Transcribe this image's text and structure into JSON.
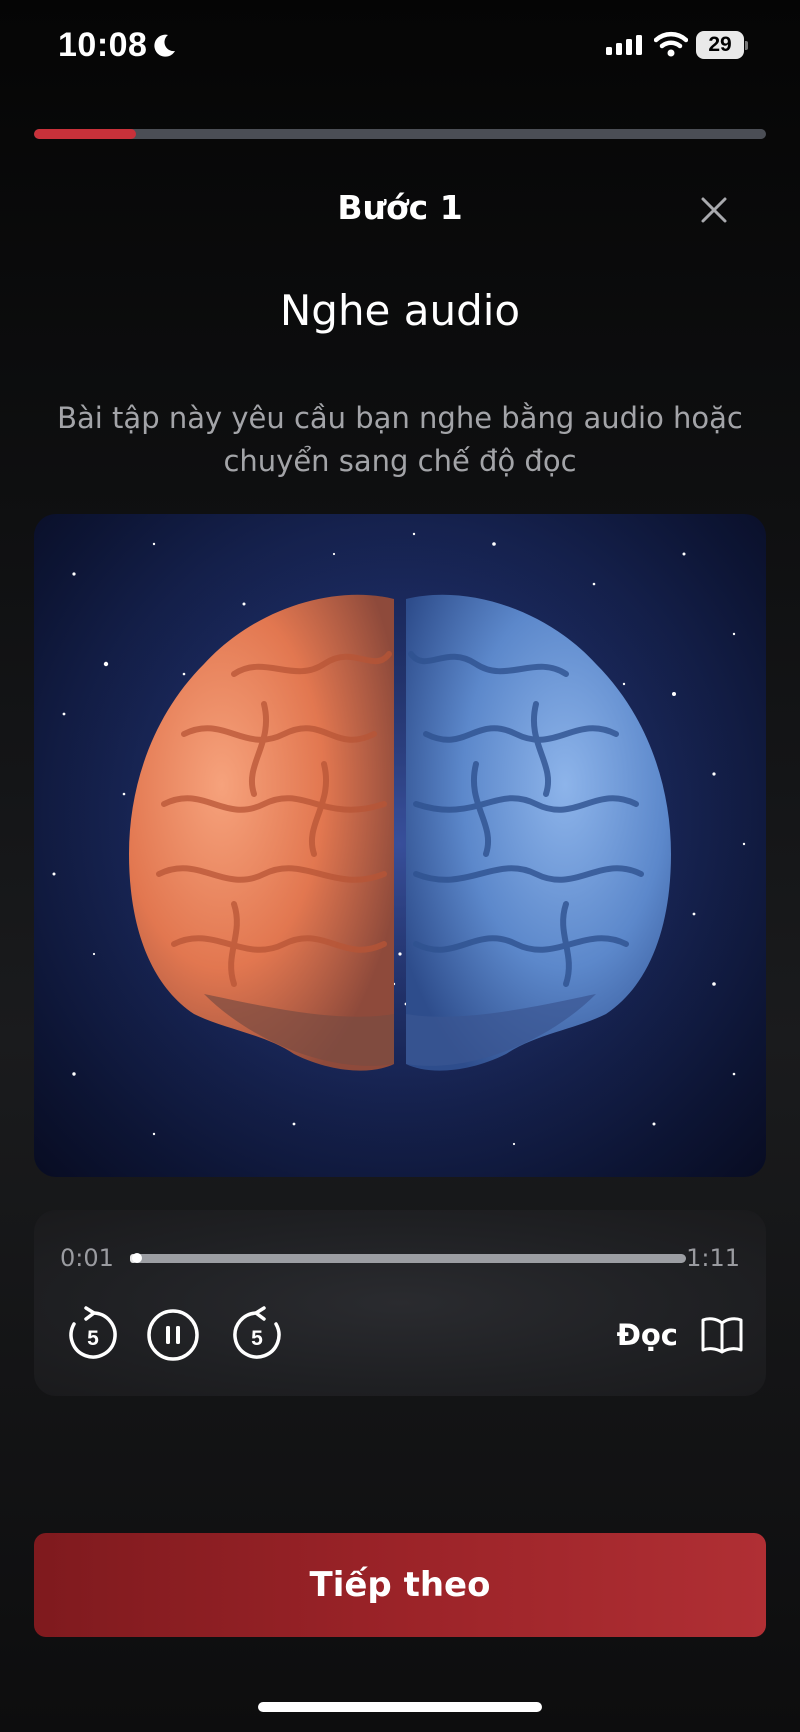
{
  "status_bar": {
    "time": "10:08",
    "battery": "29"
  },
  "progress": {
    "fraction": 0.14,
    "color": "#c8313a"
  },
  "header": {
    "step_title": "Bước 1",
    "close_icon": "close-icon"
  },
  "page_title": "Nghe audio",
  "description": "Bài tập này yêu cầu bạn nghe bằng audio hoặc chuyển sang chế độ đọc",
  "hero_image": {
    "subject": "brain-illustration",
    "colors": {
      "left": "#e9835a",
      "right": "#5f8fd2",
      "sky": "#1b2a5f"
    }
  },
  "player": {
    "current_time": "0:01",
    "total_time": "1:11",
    "seek_fraction": 0.01,
    "rewind_seconds": "5",
    "forward_seconds": "5",
    "read_label": "Đọc"
  },
  "next_button": {
    "label": "Tiếp theo",
    "color": "#9b2328"
  }
}
